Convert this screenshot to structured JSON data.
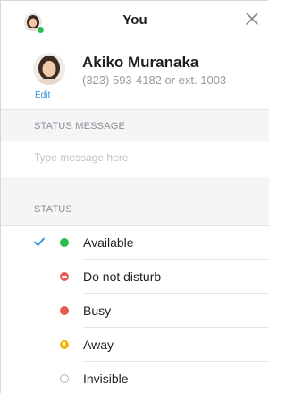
{
  "header": {
    "title": "You"
  },
  "profile": {
    "name": "Akiko Muranaka",
    "phone": "(323) 593-4182 or ext. 1003",
    "edit_label": "Edit"
  },
  "status_message": {
    "section_label": "STATUS MESSAGE",
    "placeholder": "Type message here",
    "value": ""
  },
  "status": {
    "section_label": "STATUS",
    "selected": "Available",
    "options": [
      {
        "label": "Available",
        "icon": "available-dot-icon",
        "color": "#2bbd4d",
        "selected": true
      },
      {
        "label": "Do not disturb",
        "icon": "do-not-disturb-icon",
        "color": "#e8594f",
        "selected": false
      },
      {
        "label": "Busy",
        "icon": "busy-dot-icon",
        "color": "#e8594f",
        "selected": false
      },
      {
        "label": "Away",
        "icon": "away-clock-icon",
        "color": "#f4b400",
        "selected": false
      },
      {
        "label": "Invisible",
        "icon": "invisible-circle-icon",
        "color": "#b5b5b5",
        "selected": false
      }
    ]
  },
  "colors": {
    "accent": "#2b8fe0",
    "available": "#2bbd4d",
    "busy": "#e8594f",
    "away": "#f4b400"
  }
}
